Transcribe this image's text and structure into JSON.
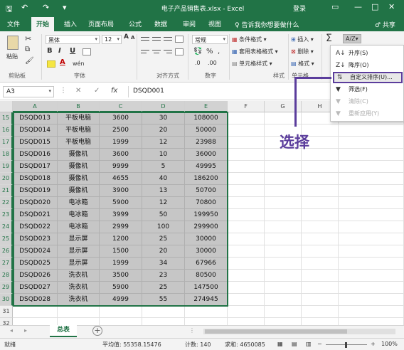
{
  "titlebar": {
    "title": "电子产品销售表.xlsx - Excel",
    "login": "登录",
    "save_icon": "save-icon",
    "undo_icon": "undo-icon",
    "redo_icon": "redo-icon",
    "restore_icon": "restore-icon",
    "minimize": "—",
    "maximize": "□",
    "close": "✕",
    "brand_color": "#217346"
  },
  "tabs": [
    "文件",
    "开始",
    "插入",
    "页面布局",
    "公式",
    "数据",
    "审阅",
    "视图"
  ],
  "active_tab": "开始",
  "tellme": "♀ 告诉我你想要做什么",
  "share": "♂ 共享",
  "ribbon": {
    "paste": "粘贴",
    "font_name": "黑体",
    "font_size": "12",
    "bold": "B",
    "italic": "I",
    "underline": "U",
    "grow_font": "A",
    "shrink_font": "A",
    "font_color": "A",
    "wen": "wén",
    "number_format": "常规",
    "percent": "%",
    "comma": ",",
    "cond_format": "条件格式 ▾",
    "table_format": "套用表格格式 ▾",
    "cell_style": "单元格样式 ▾",
    "insert": "插入 ▾",
    "delete": "删除 ▾",
    "format": "格式 ▾",
    "sigma": "Σ",
    "sort_filter": "A/Z▾",
    "groups": {
      "clipboard": "剪贴板",
      "font": "字体",
      "alignment": "对齐方式",
      "number": "数字",
      "styles": "样式",
      "cells": "单元格"
    }
  },
  "formula_bar": {
    "name_box": "A3",
    "cancel": "✕",
    "enter": "✓",
    "fx": "fx",
    "content": "DSQD001"
  },
  "columns": [
    "A",
    "B",
    "C",
    "D",
    "E",
    "F",
    "G",
    "H"
  ],
  "rows": [
    {
      "num": "15",
      "a": "DSQD013",
      "b": "平板电脑",
      "c": "3600",
      "d": "30",
      "e": "108000"
    },
    {
      "num": "16",
      "a": "DSQD014",
      "b": "平板电脑",
      "c": "2500",
      "d": "20",
      "e": "50000"
    },
    {
      "num": "17",
      "a": "DSQD015",
      "b": "平板电脑",
      "c": "1999",
      "d": "12",
      "e": "23988"
    },
    {
      "num": "18",
      "a": "DSQD016",
      "b": "摄像机",
      "c": "3600",
      "d": "10",
      "e": "36000"
    },
    {
      "num": "19",
      "a": "DSQD017",
      "b": "摄像机",
      "c": "9999",
      "d": "5",
      "e": "49995"
    },
    {
      "num": "20",
      "a": "DSQD018",
      "b": "摄像机",
      "c": "4655",
      "d": "40",
      "e": "186200"
    },
    {
      "num": "21",
      "a": "DSQD019",
      "b": "摄像机",
      "c": "3900",
      "d": "13",
      "e": "50700"
    },
    {
      "num": "22",
      "a": "DSQD020",
      "b": "电冰箱",
      "c": "5900",
      "d": "12",
      "e": "70800"
    },
    {
      "num": "23",
      "a": "DSQD021",
      "b": "电冰箱",
      "c": "3999",
      "d": "50",
      "e": "199950"
    },
    {
      "num": "24",
      "a": "DSQD022",
      "b": "电冰箱",
      "c": "2999",
      "d": "100",
      "e": "299900"
    },
    {
      "num": "25",
      "a": "DSQD023",
      "b": "显示屏",
      "c": "1200",
      "d": "25",
      "e": "30000"
    },
    {
      "num": "26",
      "a": "DSQD024",
      "b": "显示屏",
      "c": "1500",
      "d": "20",
      "e": "30000"
    },
    {
      "num": "27",
      "a": "DSQD025",
      "b": "显示屏",
      "c": "1999",
      "d": "34",
      "e": "67966"
    },
    {
      "num": "28",
      "a": "DSQD026",
      "b": "洗衣机",
      "c": "3500",
      "d": "23",
      "e": "80500"
    },
    {
      "num": "29",
      "a": "DSQD027",
      "b": "洗衣机",
      "c": "5900",
      "d": "25",
      "e": "147500"
    },
    {
      "num": "30",
      "a": "DSQD028",
      "b": "洗衣机",
      "c": "4999",
      "d": "55",
      "e": "274945"
    },
    {
      "num": "31",
      "a": "",
      "b": "",
      "c": "",
      "d": "",
      "e": ""
    },
    {
      "num": "32",
      "a": "",
      "b": "",
      "c": "",
      "d": "",
      "e": ""
    }
  ],
  "sheet_tab": "总表",
  "add_sheet": "+",
  "status": {
    "ready": "就绪",
    "average": "平均值: 55358.15476",
    "count": "计数: 140",
    "sum": "求和: 4650085",
    "zoom": "100%",
    "zoom_minus": "−",
    "zoom_plus": "+"
  },
  "dropdown": {
    "items": [
      {
        "label": "升序(S)",
        "icon": "sort-asc-icon",
        "disabled": false
      },
      {
        "label": "降序(O)",
        "icon": "sort-desc-icon",
        "disabled": false
      },
      {
        "label": "自定义排序(U)...",
        "icon": "custom-sort-icon",
        "disabled": false,
        "highlighted": true
      },
      {
        "label": "筛选(F)",
        "icon": "filter-icon",
        "disabled": false
      },
      {
        "label": "清除(C)",
        "icon": "clear-filter-icon",
        "disabled": true
      },
      {
        "label": "重新应用(Y)",
        "icon": "reapply-icon",
        "disabled": true
      }
    ]
  },
  "annotation": {
    "text": "选择",
    "color": "#5b3d9c"
  }
}
